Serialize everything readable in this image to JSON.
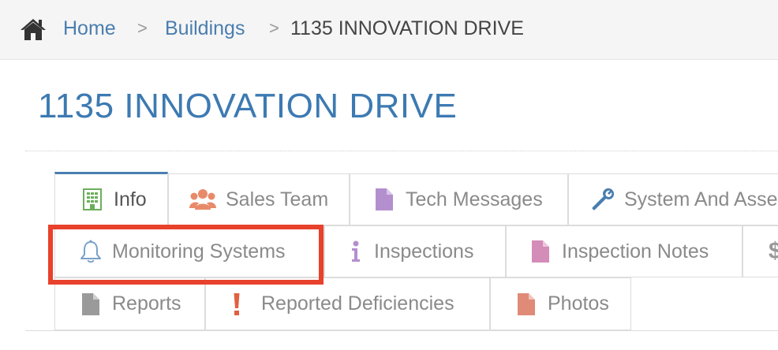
{
  "breadcrumb": {
    "home": "Home",
    "buildings": "Buildings",
    "current": "1135 INNOVATION DRIVE",
    "separator": ">"
  },
  "page": {
    "title": "1135 INNOVATION DRIVE"
  },
  "tabs": {
    "row1": [
      {
        "label": "Info",
        "icon": "building-icon",
        "color": "#6cae5b",
        "active": true
      },
      {
        "label": "Sales Team",
        "icon": "users-icon",
        "color": "#e88a6a"
      },
      {
        "label": "Tech Messages",
        "icon": "file-icon",
        "color": "#b48fce"
      },
      {
        "label": "System And Asse",
        "icon": "wrench-icon",
        "color": "#4a7eb0"
      }
    ],
    "row2": [
      {
        "label": "Monitoring Systems",
        "icon": "bell-icon",
        "color": "#7aa0c9"
      },
      {
        "label": "Inspections",
        "icon": "info-icon",
        "color": "#b48fce"
      },
      {
        "label": "Inspection Notes",
        "icon": "file-icon",
        "color": "#d48cb8"
      },
      {
        "label": "$",
        "icon": "dollar-icon",
        "color": "#999999"
      }
    ],
    "row3": [
      {
        "label": "Reports",
        "icon": "file-icon",
        "color": "#9a9a9a"
      },
      {
        "label": "Reported Deficiencies",
        "icon": "exclamation-icon",
        "color": "#e06040"
      },
      {
        "label": "Photos",
        "icon": "file-icon",
        "color": "#e08a78"
      }
    ]
  },
  "colors": {
    "link": "#4a7eb0",
    "title": "#3d7ab2",
    "highlight": "#e8412c"
  }
}
